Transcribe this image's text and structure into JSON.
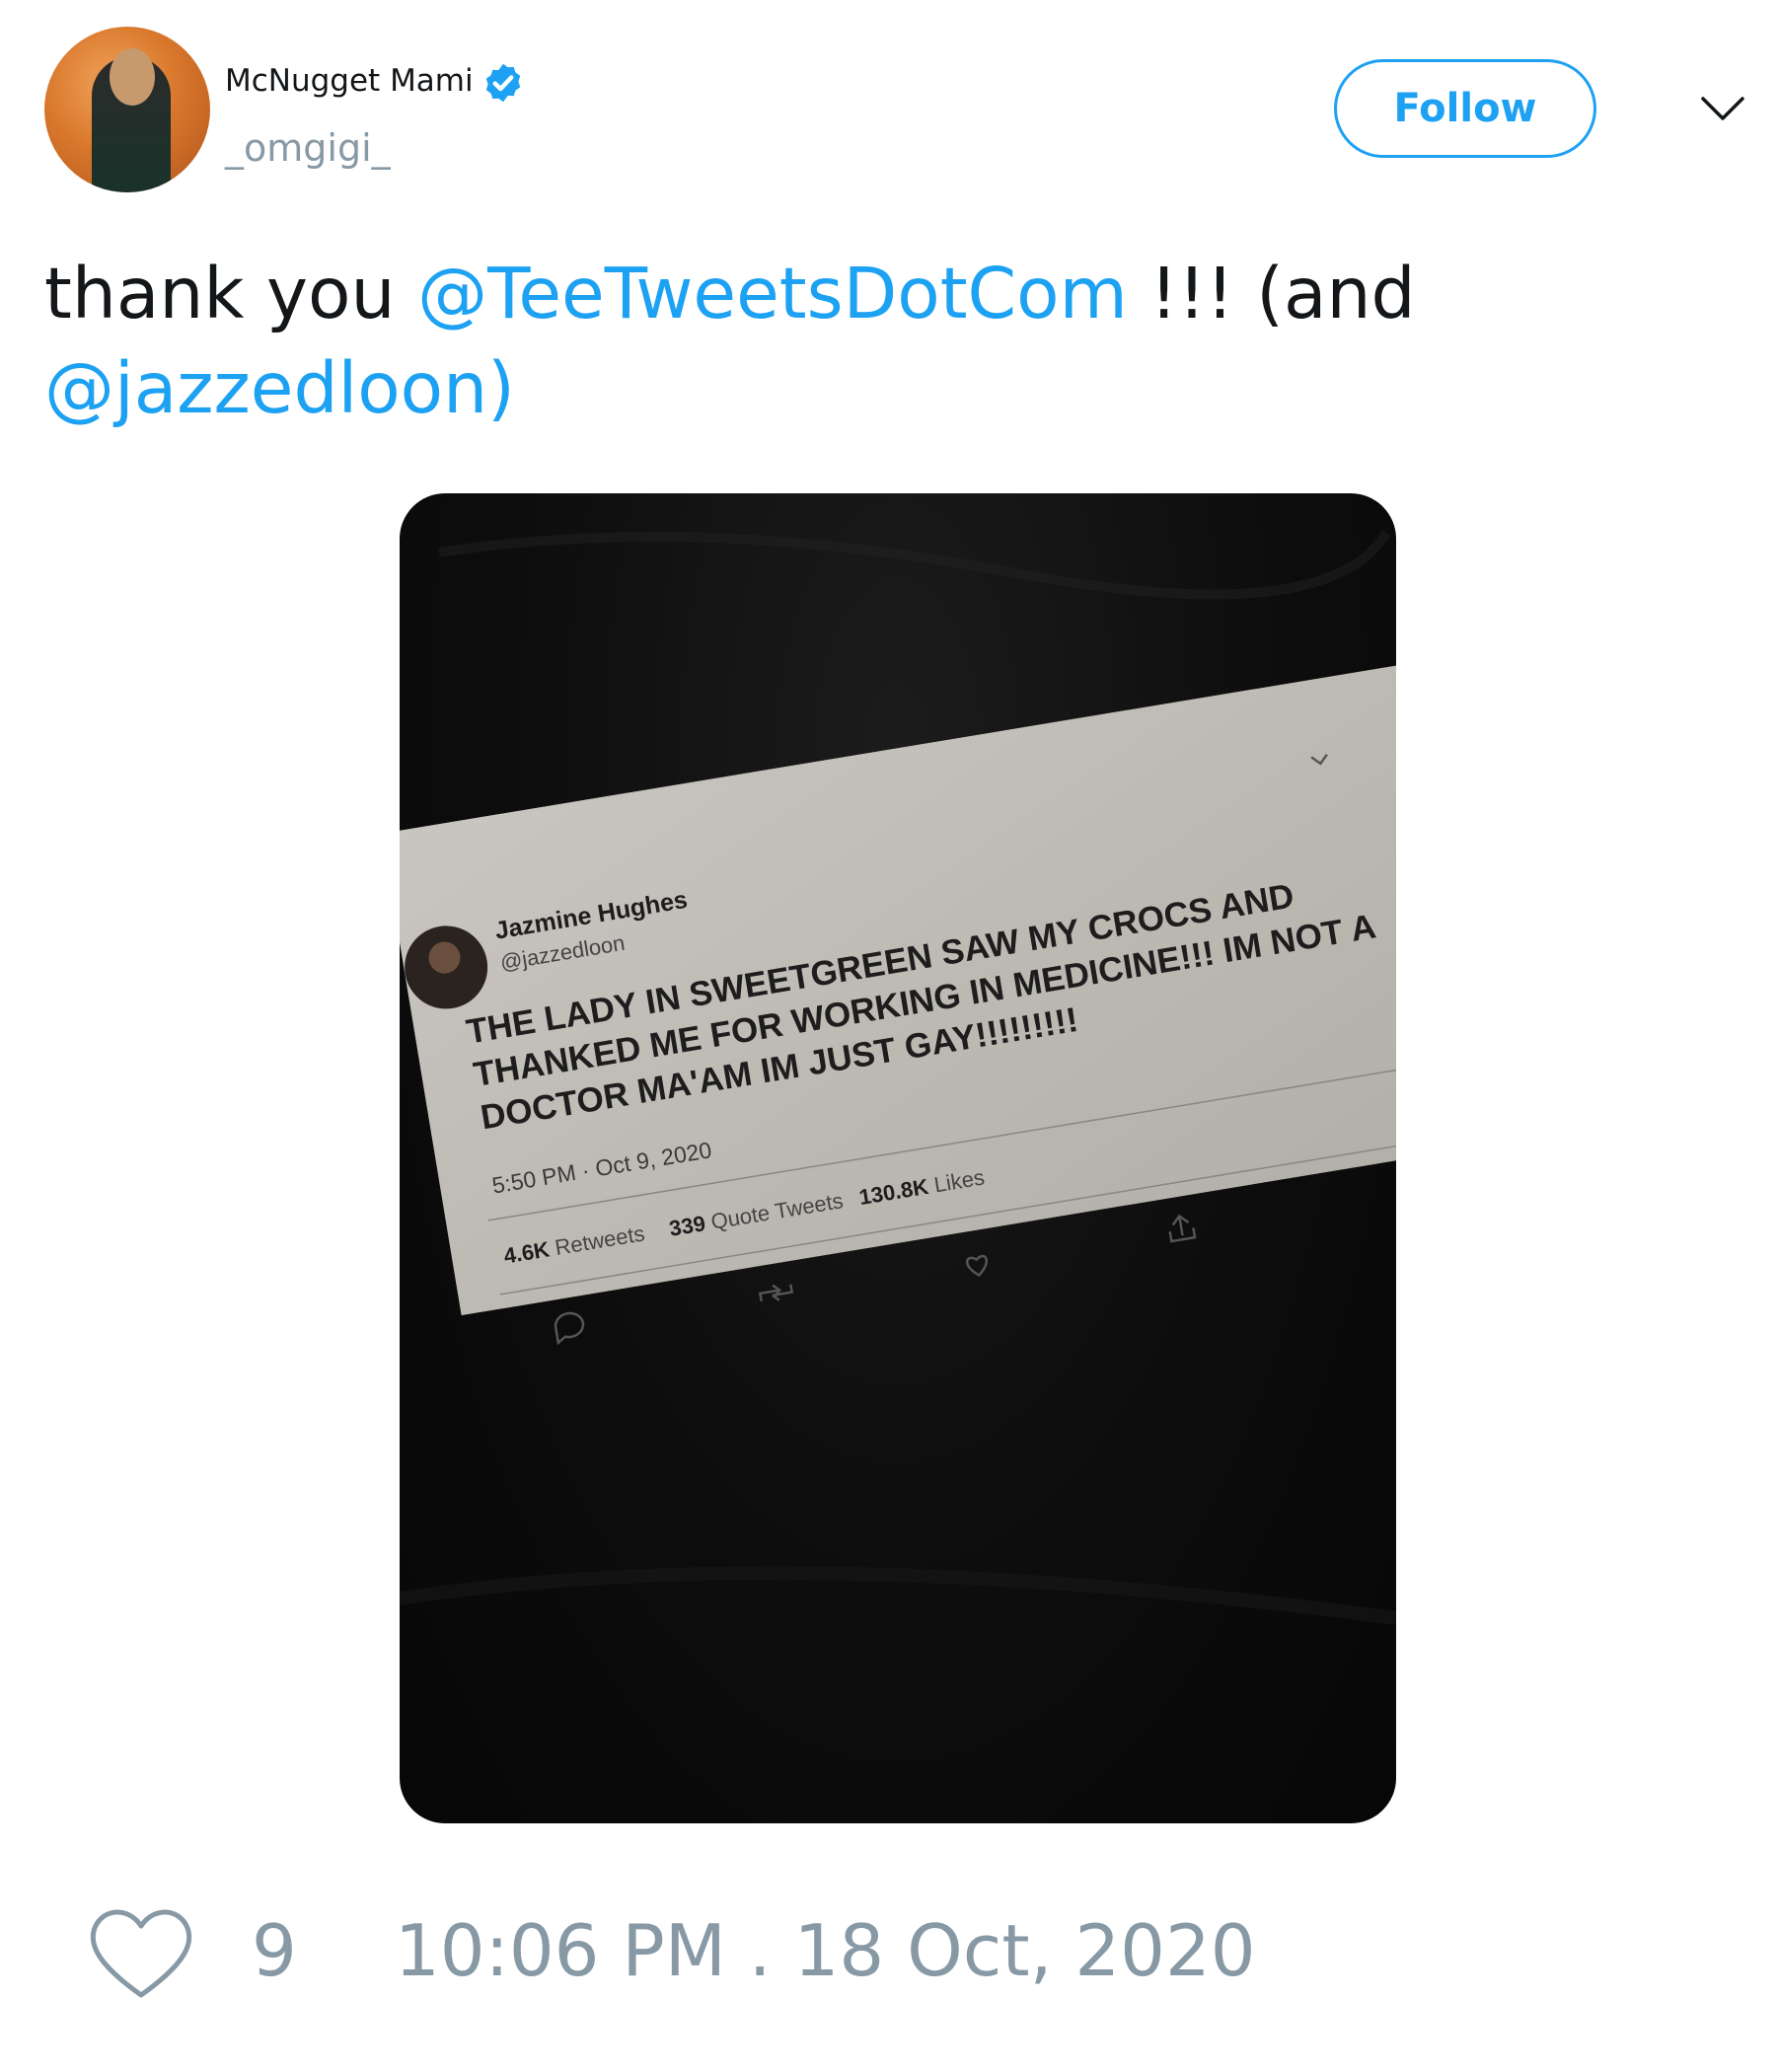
{
  "author": {
    "display_name": "McNugget Mami",
    "handle": "_omgigi_"
  },
  "follow_label": "Follow",
  "tweet": {
    "text_pre": "thank you ",
    "mention_1": "@TeeTweetsDotCom",
    "text_mid": " !!! (and ",
    "mention_2": "@jazzedloon)"
  },
  "printed_tweet": {
    "name": "Jazmine Hughes",
    "handle": "@jazzedloon",
    "lines": [
      "THE LADY IN SWEETGREEN SAW MY CROCS AND",
      "THANKED ME FOR WORKING IN MEDICINE!!! IM NOT A",
      "DOCTOR MA'AM IM JUST GAY!!!!!!!!!"
    ],
    "time": "5:50 PM · Oct 9, 2020",
    "retweets_count": "4.6K",
    "retweets_label": " Retweets",
    "quote_count": "339",
    "quote_label": " Quote Tweets",
    "likes_count": "130.8K",
    "likes_label": " Likes"
  },
  "footer": {
    "likes": "9",
    "timestamp": "10:06 PM . 18 Oct, 2020"
  },
  "colors": {
    "accent": "#1da1f2",
    "muted": "#8899a6",
    "text": "#14171a"
  },
  "icons": [
    "verified-badge-icon",
    "chevron-down-icon",
    "heart-icon",
    "reply-icon",
    "retweet-icon",
    "share-icon"
  ]
}
